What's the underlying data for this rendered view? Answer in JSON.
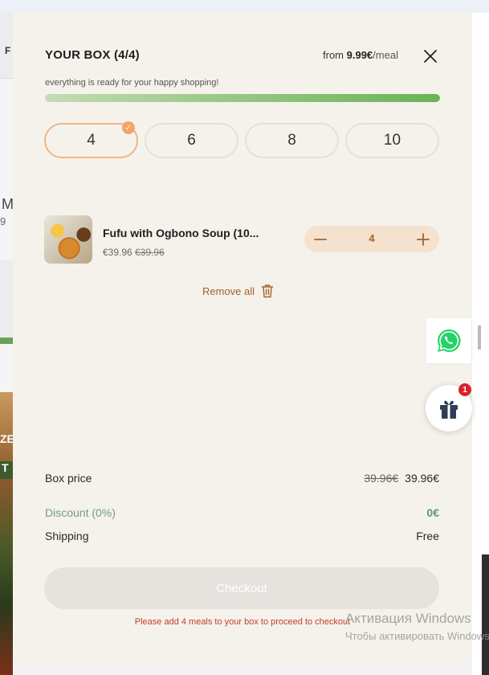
{
  "background": {
    "header_text": "F",
    "left_letter_m": "M",
    "left_number": "9",
    "photo_text_1": "ZE",
    "photo_text_2": "T",
    "watermark_line1": "Активация Windows",
    "watermark_line2": "Чтобы активировать Windows"
  },
  "box": {
    "title": "YOUR BOX (4/4)",
    "price_from_prefix": "from ",
    "price_from_amount": "9.99€",
    "price_from_unit": "/meal",
    "ready_text": "everything is ready for your happy shopping!",
    "progress_fraction": 1.0,
    "sizes": [
      "4",
      "6",
      "8",
      "10"
    ],
    "selected_size": "4"
  },
  "item": {
    "name": "Fufu with Ogbono Soup (10...",
    "price": "€39.96",
    "old_price": "€39.96",
    "quantity": "4"
  },
  "remove_all_label": "Remove all",
  "summary": {
    "box_price_label": "Box price",
    "box_price_old": "39.96€",
    "box_price": "39.96€",
    "discount_label": "Discount (0%)",
    "discount_value": "0€",
    "shipping_label": "Shipping",
    "shipping_value": "Free"
  },
  "checkout_label": "Checkout",
  "checkout_warning": "Please add 4 meals to your box to proceed to checkout",
  "gift_badge_count": "1",
  "colors": {
    "accent_orange": "#f0b682",
    "stepper_bg": "#f4e2ce",
    "stepper_text": "#a0622e",
    "progress_green": "#6ab356",
    "warning_red": "#c2402b",
    "whatsapp_green": "#25d366"
  },
  "icons": {
    "close": "close-icon",
    "check": "check-icon",
    "minus": "minus-icon",
    "plus": "plus-icon",
    "trash": "trash-icon",
    "whatsapp": "whatsapp-icon",
    "gift": "gift-icon"
  }
}
